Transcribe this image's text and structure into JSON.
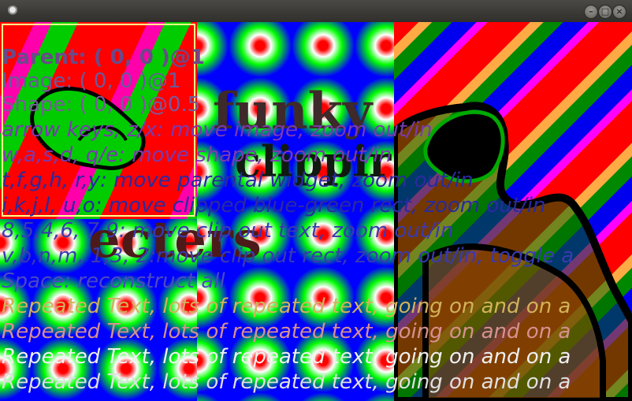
{
  "window": {
    "title": "",
    "buttons": {
      "minimize": "–",
      "maximize": "□",
      "close": "×"
    }
  },
  "scene": {
    "funky_words": [
      "funky",
      "clippir",
      "ecters"
    ]
  },
  "overlay_lines": [
    {
      "text": "Parent: ( 0, 0 )@1",
      "color": "#6a4a8a",
      "style": "b"
    },
    {
      "text": "Image: ( 0, 0 )@1",
      "color": "#6a5a9a",
      "style": ""
    },
    {
      "text": "Shape: ( 0, 0 )@0.5",
      "color": "#7a5a9a",
      "style": ""
    },
    {
      "text": "arrow keys, z/x: move image, zoom out/in",
      "color": "#7a3ab0",
      "style": "i"
    },
    {
      "text": "w,a,s,d, q/e: move shape, zoom out/in",
      "color": "#7a3ab0",
      "style": "i"
    },
    {
      "text": "t,f,g,h, r,y: move parental widget, zoom out/in",
      "color": "#2a2aa0",
      "style": "i"
    },
    {
      "text": "i,k,j,l, u,o: move clipped blue-green rect, zoom out/in",
      "color": "#2a2aa0",
      "style": "i"
    },
    {
      "text": "8,5,4,6, 7,9: move clip out text, zoom out/in",
      "color": "#3a3ab0",
      "style": "i"
    },
    {
      "text": "v,b,n,m, 1,3, 2:move clip out rect, zoom out/in, toggle a",
      "color": "#3a3ab0",
      "style": "i"
    },
    {
      "text": "Space: reconstruct all",
      "color": "#4a4ac0",
      "style": "i"
    },
    {
      "text": "Repeated Text, lots of repeated text, going on and on a",
      "color": "#d2b25a",
      "style": "i"
    },
    {
      "text": "Repeated Text, lots of repeated text, going on and on a",
      "color": "#d89090",
      "style": "i"
    },
    {
      "text": "Repeated Text, lots of repeated text, going on and on a",
      "color": "#f0f0f0",
      "style": "i"
    },
    {
      "text": "Repeated Text, lots of repeated text, going on and on a",
      "color": "#e0e0e0",
      "style": "i"
    }
  ],
  "colors": {
    "accent_clip_border": "#ffff88",
    "titlebar": "#3a3935"
  }
}
